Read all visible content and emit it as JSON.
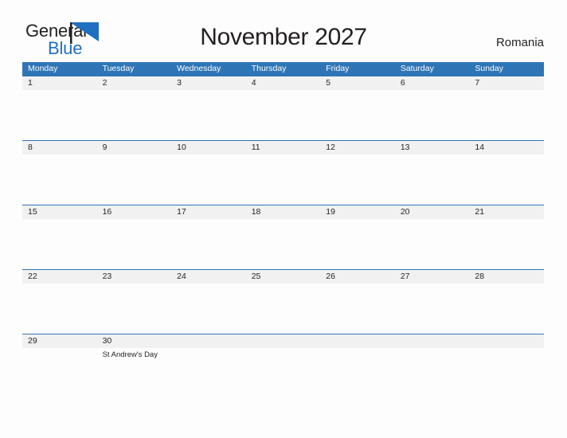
{
  "brand": {
    "word_one": "General",
    "word_two": "Blue",
    "flag_icon": "blue-triangle-flag-icon",
    "word_one_color": "#231f20",
    "word_two_color": "#1f6fc0",
    "flag_color": "#1f6fc0"
  },
  "header": {
    "title": "November 2027",
    "country": "Romania"
  },
  "theme": {
    "header_bar_color": "#2e75b6",
    "date_band_color": "#f1f1f1",
    "rule_color": "#2e75b6",
    "page_background": "#fdfdfd",
    "text_color": "#231f20"
  },
  "calendar": {
    "weekday_headers": [
      "Monday",
      "Tuesday",
      "Wednesday",
      "Thursday",
      "Friday",
      "Saturday",
      "Sunday"
    ],
    "weeks": [
      {
        "dates": [
          "1",
          "2",
          "3",
          "4",
          "5",
          "6",
          "7"
        ],
        "events": [
          "",
          "",
          "",
          "",
          "",
          "",
          ""
        ]
      },
      {
        "dates": [
          "8",
          "9",
          "10",
          "11",
          "12",
          "13",
          "14"
        ],
        "events": [
          "",
          "",
          "",
          "",
          "",
          "",
          ""
        ]
      },
      {
        "dates": [
          "15",
          "16",
          "17",
          "18",
          "19",
          "20",
          "21"
        ],
        "events": [
          "",
          "",
          "",
          "",
          "",
          "",
          ""
        ]
      },
      {
        "dates": [
          "22",
          "23",
          "24",
          "25",
          "26",
          "27",
          "28"
        ],
        "events": [
          "",
          "",
          "",
          "",
          "",
          "",
          ""
        ]
      },
      {
        "dates": [
          "29",
          "30",
          "",
          "",
          "",
          "",
          ""
        ],
        "events": [
          "",
          "St Andrew's Day",
          "",
          "",
          "",
          "",
          ""
        ]
      }
    ]
  }
}
